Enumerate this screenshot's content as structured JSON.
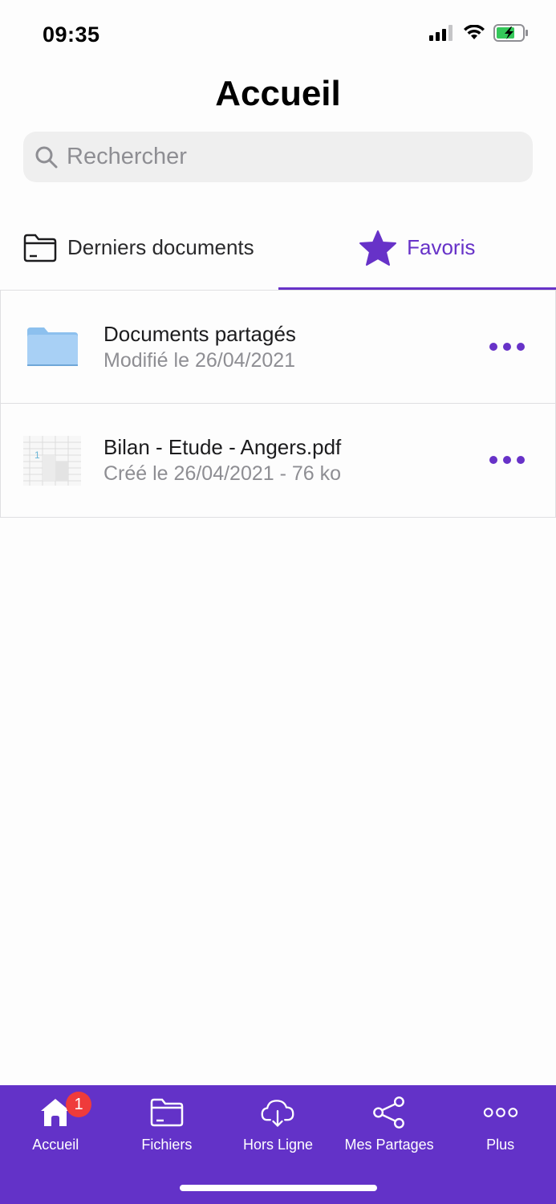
{
  "status_bar": {
    "time": "09:35"
  },
  "header": {
    "title": "Accueil"
  },
  "search": {
    "placeholder": "Rechercher",
    "value": ""
  },
  "tabs": [
    {
      "label": "Derniers documents",
      "icon": "folder-outline-icon",
      "active": false
    },
    {
      "label": "Favoris",
      "icon": "star-icon",
      "active": true
    }
  ],
  "items": [
    {
      "title": "Documents partagés",
      "subtitle": "Modifié le 26/04/2021",
      "icon": "folder-icon"
    },
    {
      "title": "Bilan - Etude - Angers.pdf",
      "subtitle": "Créé le 26/04/2021 - 76 ko",
      "icon": "pdf-thumbnail"
    }
  ],
  "bottom_nav": {
    "items": [
      {
        "label": "Accueil",
        "icon": "home-icon",
        "badge": "1"
      },
      {
        "label": "Fichiers",
        "icon": "folder-icon"
      },
      {
        "label": "Hors Ligne",
        "icon": "cloud-download-icon"
      },
      {
        "label": "Mes Partages",
        "icon": "share-icon"
      },
      {
        "label": "Plus",
        "icon": "more-icon"
      }
    ]
  },
  "colors": {
    "accent": "#6732c8",
    "nav_bg": "#6332c8",
    "badge": "#ef3b3b",
    "folder": "#a8d0f5"
  }
}
